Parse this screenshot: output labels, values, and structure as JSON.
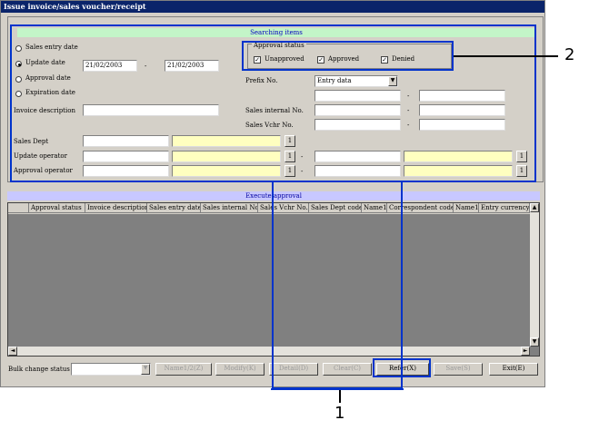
{
  "window": {
    "title": "Issue invoice/sales voucher/receipt"
  },
  "search": {
    "header": "Searching items",
    "radios": [
      {
        "label": "Sales entry date",
        "selected": false
      },
      {
        "label": "Update date",
        "selected": true
      },
      {
        "label": "Approval date",
        "selected": false
      },
      {
        "label": "Expiration date",
        "selected": false
      }
    ],
    "date_from": "21/02/2003",
    "date_separator": "-",
    "date_to": "21/02/2003",
    "invoice_description_label": "Invoice description",
    "approval_status": {
      "label": "Approval status",
      "options": [
        {
          "label": "Unapproved",
          "checked": true
        },
        {
          "label": "Approved",
          "checked": true
        },
        {
          "label": "Denied",
          "checked": true
        }
      ]
    },
    "prefix_label": "Prefix No.",
    "prefix_value": "Entry data",
    "range_separator": "-",
    "sales_internal_label": "Sales internal No.",
    "sales_vchr_label": "Sales Vchr No.",
    "sales_dept_label": "Sales Dept",
    "update_operator_label": "Update operator",
    "approval_operator_label": "Approval operator",
    "lookup_label": "1"
  },
  "results": {
    "header": "Execute approval",
    "columns": [
      "Approval status",
      "Invoice description",
      "Sales entry date",
      "Sales internal No.",
      "Sales Vchr No.",
      "Sales Dept code",
      "Name1",
      "Correspondent code",
      "Name1",
      "Entry currency"
    ]
  },
  "bottom": {
    "bulk_label": "Bulk change status",
    "buttons": {
      "name": "Name1/2(Z)",
      "modify": "Modify(K)",
      "detail": "Detail(D)",
      "clear": "Clear(C)",
      "refer": "Refer(X)",
      "save": "Save(S)",
      "exit": "Exit(E)"
    }
  },
  "callouts": {
    "one": "1",
    "two": "2"
  },
  "colors": {
    "highlight": "#0033cc",
    "title_bar": "#0a246a",
    "section_header": "#c3f5c8",
    "lookup_fill": "#ffffc0"
  }
}
